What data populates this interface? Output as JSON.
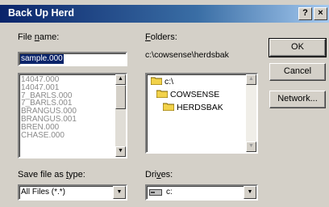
{
  "window": {
    "title": "Back Up Herd",
    "help_label": "?",
    "close_label": "×"
  },
  "file_name": {
    "label_pre": "File ",
    "label_hot": "n",
    "label_post": "ame:",
    "value": "sample.000",
    "items": [
      "14047.000",
      "14047.001",
      "7_BARLS.000",
      "7_BARLS.001",
      "BRANGUS.000",
      "BRANGUS.001",
      "BREN.000",
      "CHASE.000"
    ]
  },
  "folders": {
    "label_pre": "",
    "label_hot": "F",
    "label_post": "olders:",
    "path": "c:\\cowsense\\herdsbak",
    "items": [
      {
        "name": "c:\\"
      },
      {
        "name": "COWSENSE"
      },
      {
        "name": "HERDSBAK"
      }
    ]
  },
  "save_type": {
    "label_pre": "Save file as ",
    "label_hot": "t",
    "label_post": "ype:",
    "value": "All Files (*.*)"
  },
  "drives": {
    "label_pre": "Dri",
    "label_hot": "v",
    "label_post": "es:",
    "value": "c:"
  },
  "buttons": {
    "ok": "OK",
    "cancel": "Cancel",
    "network": "Network..."
  },
  "colors": {
    "folder_yellow": "#f2d24a",
    "selection": "#0a246a"
  }
}
